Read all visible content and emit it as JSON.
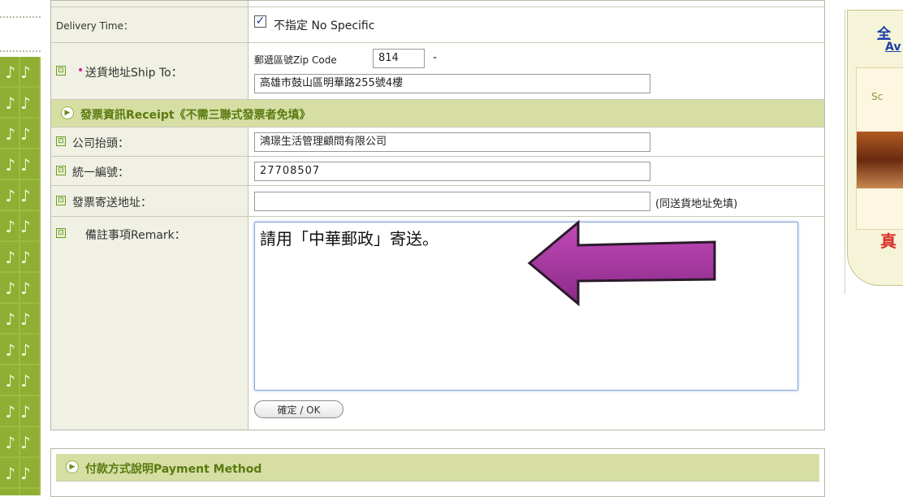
{
  "delivery_time": {
    "label": "Delivery Time：",
    "checkbox_label": "不指定 No Specific",
    "checked": true
  },
  "ship_to": {
    "label": "送貨地址Ship To：",
    "zip_label": "郵遞區號Zip Code",
    "zip_value": "814",
    "zip_dash": "-",
    "address_value": "高雄市鼓山區明華路255號4樓"
  },
  "receipt_section": {
    "title": "發票資訊Receipt《不需三聯式發票者免填》"
  },
  "company": {
    "label": "公司抬頭：",
    "value": "鴻璟生活管理顧問有限公司"
  },
  "tax_id": {
    "label": "統一編號：",
    "value": "27708507"
  },
  "invoice_address": {
    "label": "發票寄送地址：",
    "value": "",
    "note": "(同送貨地址免填)"
  },
  "remark": {
    "label": "備註事項Remark：",
    "value": "請用「中華郵政」寄送。",
    "ok_button": "確定 / OK"
  },
  "payment_section": {
    "title": "付款方式說明Payment Method"
  },
  "right_banner": {
    "link1": "全",
    "link2": "Av",
    "logo": "Sc",
    "red_text": "真"
  },
  "colors": {
    "arrow": "#a0309a",
    "section_header": "#d6dea3",
    "link": "#1a3fa8"
  }
}
